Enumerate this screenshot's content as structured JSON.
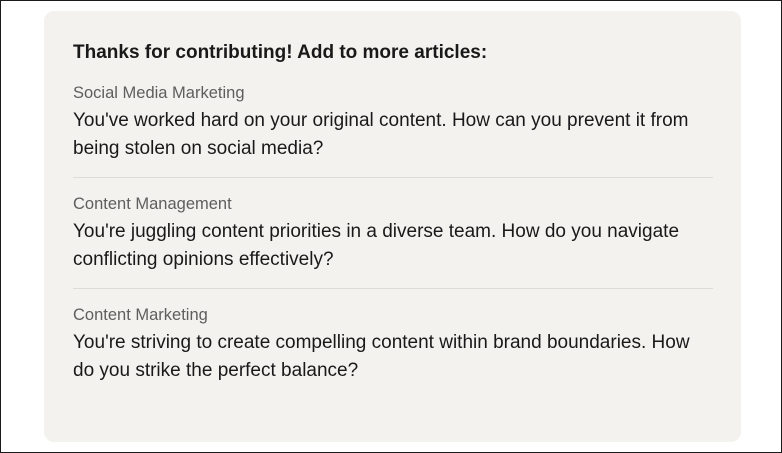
{
  "card": {
    "heading": "Thanks for contributing! Add to more articles:"
  },
  "articles": [
    {
      "topic": "Social Media Marketing",
      "question": "You've worked hard on your original content. How can you prevent it from being stolen on social media?"
    },
    {
      "topic": "Content Management",
      "question": "You're juggling content priorities in a diverse team. How do you navigate conflicting opinions effectively?"
    },
    {
      "topic": "Content Marketing",
      "question": "You're striving to create compelling content within brand boundaries. How do you strike the perfect balance?"
    }
  ]
}
